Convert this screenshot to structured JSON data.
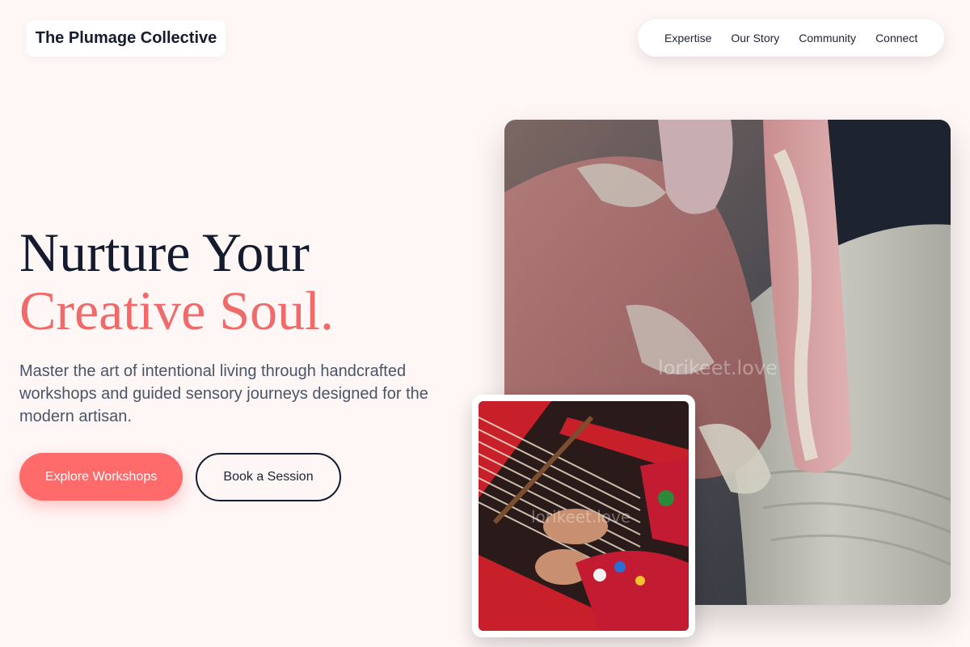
{
  "brand": {
    "name": "The Plumage Collective"
  },
  "nav": {
    "links": [
      "Expertise",
      "Our Story",
      "Community",
      "Connect"
    ]
  },
  "hero": {
    "headline_line1": "Nurture Your",
    "headline_line2": "Creative Soul.",
    "description": "Master the art of intentional living through handcrafted workshops and guided sensory journeys designed for the modern artisan.",
    "primary_cta": "Explore Workshops",
    "secondary_cta": "Book a Session"
  },
  "images": {
    "main": {
      "watermark": "lorikeet.love"
    },
    "inset": {
      "watermark": "lorikeet.love"
    }
  },
  "colors": {
    "background": "#fef7f6",
    "accent": "#ff6b6b",
    "headline_accent": "#f06a6a",
    "ink": "#141b2f"
  }
}
